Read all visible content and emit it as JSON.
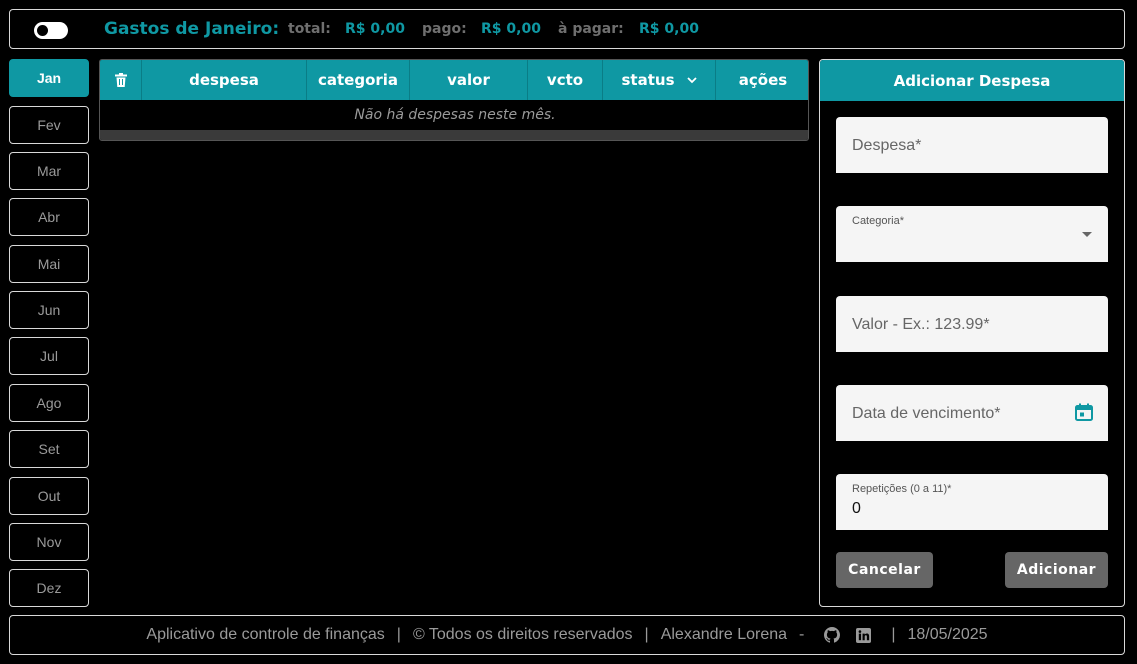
{
  "header": {
    "toggle_state": "off",
    "title": "Gastos de Janeiro:",
    "total_label": "total:",
    "total_value": "R$ 0,00",
    "paid_label": "pago:",
    "paid_value": "R$ 0,00",
    "topay_label": "à pagar:",
    "topay_value": "R$ 0,00",
    "accent_color": "#0f98a3"
  },
  "months": [
    "Jan",
    "Fev",
    "Mar",
    "Abr",
    "Mai",
    "Jun",
    "Jul",
    "Ago",
    "Set",
    "Out",
    "Nov",
    "Dez"
  ],
  "active_month": "Jan",
  "table": {
    "columns": [
      "despesa",
      "categoria",
      "valor",
      "vcto",
      "status",
      "ações"
    ],
    "delete_icon": "trash-icon",
    "status_icon": "chevron-down-icon",
    "empty_message": "Não há despesas neste mês."
  },
  "form": {
    "title": "Adicionar Despesa",
    "expense_placeholder": "Despesa*",
    "category_label": "Categoria*",
    "value_placeholder": "Valor - Ex.: 123.99*",
    "due_date_placeholder": "Data de vencimento*",
    "repetitions_label": "Repetições (0 a 11)*",
    "repetitions_value": "0",
    "cancel_label": "Cancelar",
    "add_label": "Adicionar"
  },
  "footer": {
    "app_text": "Aplicativo de controle de finanças",
    "rights_text": "© Todos os direitos reservados",
    "author": "Alexandre Lorena",
    "dash": "-",
    "date": "18/05/2025",
    "icons": [
      "github-icon",
      "linkedin-icon"
    ]
  }
}
